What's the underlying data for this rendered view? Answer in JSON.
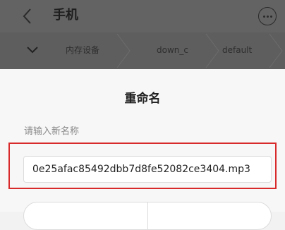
{
  "header": {
    "title": "手机",
    "back_icon": "chevron-left-icon",
    "more_icon": "more-horizontal-icon"
  },
  "breadcrumb": {
    "toggle_icon": "chevron-down-icon",
    "items": [
      "内存设备",
      "down_c",
      "default"
    ]
  },
  "dialog": {
    "title": "重命名",
    "hint": "请输入新名称",
    "input_value": "0e25afac85492dbb7d8fe52082ce3404.mp3"
  },
  "colors": {
    "highlight": "#d82a2a",
    "overlay": "#636363"
  }
}
